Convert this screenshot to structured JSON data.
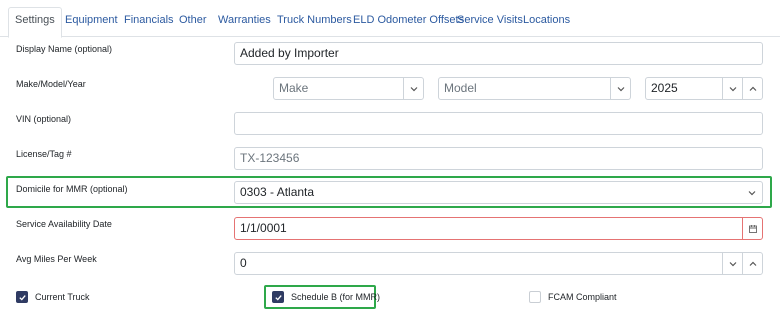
{
  "tabs": [
    "Settings",
    "Equipment",
    "Financials",
    "Other",
    "Warranties",
    "Truck Numbers",
    "ELD Odometer Offsets",
    "Service Visits",
    "Locations"
  ],
  "form": {
    "display_name": {
      "label": "Display Name (optional)",
      "value": "Added by Importer"
    },
    "make_model_year": {
      "label": "Make/Model/Year",
      "make_placeholder": "Make",
      "model_placeholder": "Model",
      "year_value": "2025"
    },
    "vin": {
      "label": "VIN (optional)",
      "value": ""
    },
    "license": {
      "label": "License/Tag #",
      "placeholder": "TX-123456"
    },
    "domicile": {
      "label": "Domicile for MMR (optional)",
      "value": "0303 - Atlanta"
    },
    "service_date": {
      "label": "Service Availability Date",
      "value": "1/1/0001"
    },
    "avg_miles": {
      "label": "Avg Miles Per Week",
      "value": "0"
    }
  },
  "checkboxes": {
    "current_truck": {
      "label": "Current Truck",
      "checked": true
    },
    "schedule_b": {
      "label": "Schedule B (for MMR)",
      "checked": true
    },
    "fcam": {
      "label": "FCAM Compliant",
      "checked": false
    }
  },
  "colors": {
    "highlight": "#2ea84a",
    "checkbox_checked": "#2f3b63",
    "tab_link": "#2c5aa0",
    "invalid_border": "#e57373"
  }
}
